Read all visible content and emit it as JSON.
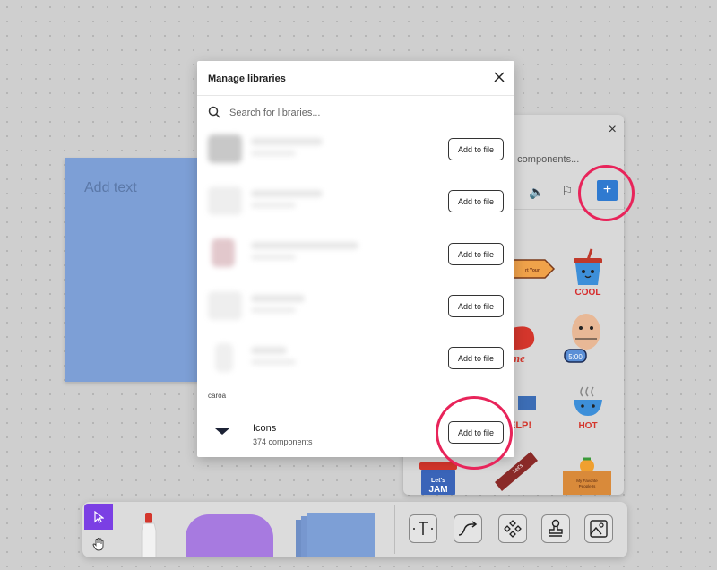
{
  "canvas": {
    "sticky_placeholder": "Add text"
  },
  "components_panel": {
    "close_glyph": "×",
    "search_partial": "d components...",
    "add_glyph": "+",
    "stickers": [
      "Let's JAM",
      "COOL",
      "5:00",
      "HOT",
      "HELP!",
      "My Favorite People Is"
    ]
  },
  "modal": {
    "title": "Manage libraries",
    "search_placeholder": "Search for libraries...",
    "libraries": [
      {
        "button": "Add to file",
        "thumb_color": "#c8c8c8"
      },
      {
        "button": "Add to file",
        "thumb_color": "#eeeeee"
      },
      {
        "button": "Add to file",
        "thumb_color": "#e2c8cc"
      },
      {
        "button": "Add to file",
        "thumb_color": "#eeeeee"
      },
      {
        "button": "Add to file",
        "thumb_color": "#efefef"
      }
    ],
    "section_label": "caroa",
    "icons_library": {
      "name": "Icons",
      "count": "374 components",
      "button": "Add to file"
    }
  },
  "colors": {
    "highlight": "#e8245a",
    "accent_purple": "#7b3fe4",
    "sticky_blue": "#7d9fd6",
    "add_blue": "#2f7ad0"
  },
  "toolbar": {
    "tools": [
      "select-tool",
      "hand-tool",
      "marker-tool",
      "shape-tool",
      "sticky-note-tool",
      "text-tool",
      "connector-tool",
      "components-tool",
      "stamp-tool",
      "image-tool"
    ]
  }
}
